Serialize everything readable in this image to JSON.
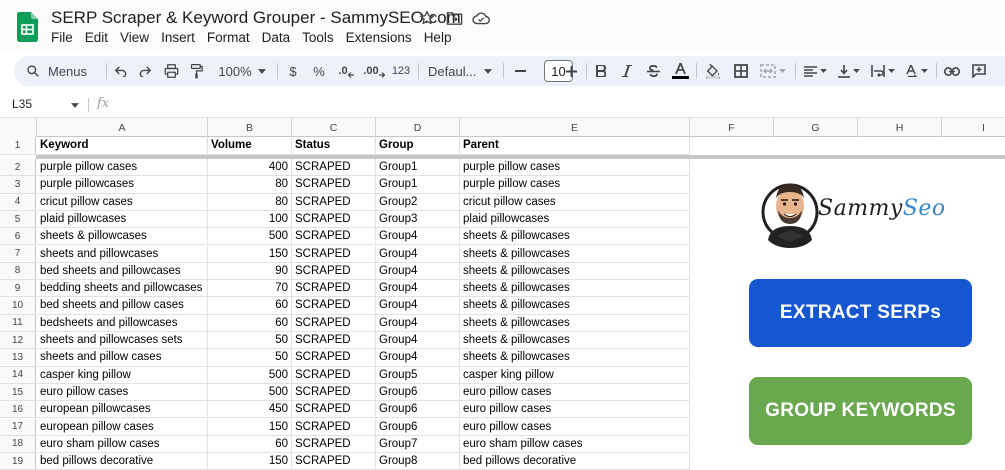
{
  "window": {
    "title": "SERP Scraper & Keyword Grouper - SammySEO.com",
    "menu": [
      "File",
      "Edit",
      "View",
      "Insert",
      "Format",
      "Data",
      "Tools",
      "Extensions",
      "Help"
    ]
  },
  "toolbar": {
    "search_label": "Menus",
    "zoom": "100%",
    "currency": "$",
    "percent": "%",
    "decrease_decimal": ".0",
    "increase_decimal": ".00",
    "number_format": "123",
    "font": "Defaul...",
    "font_size": "10"
  },
  "formula_bar": {
    "cell_ref": "L35",
    "fx": "fx"
  },
  "grid": {
    "columns": [
      "A",
      "B",
      "C",
      "D",
      "E",
      "F",
      "G",
      "H",
      "I"
    ],
    "header_row": [
      "Keyword",
      "Volume",
      "Status",
      "Group",
      "Parent"
    ],
    "rows": [
      [
        "2",
        "purple pillow cases",
        "400",
        "SCRAPED",
        "Group1",
        "purple pillow cases"
      ],
      [
        "3",
        "purple pillowcases",
        "80",
        "SCRAPED",
        "Group1",
        "purple pillow cases"
      ],
      [
        "4",
        "cricut pillow cases",
        "80",
        "SCRAPED",
        "Group2",
        "cricut pillow cases"
      ],
      [
        "5",
        "plaid pillowcases",
        "100",
        "SCRAPED",
        "Group3",
        "plaid pillowcases"
      ],
      [
        "6",
        "sheets & pillowcases",
        "500",
        "SCRAPED",
        "Group4",
        "sheets & pillowcases"
      ],
      [
        "7",
        "sheets and pillowcases",
        "150",
        "SCRAPED",
        "Group4",
        "sheets & pillowcases"
      ],
      [
        "8",
        "bed sheets and pillowcases",
        "90",
        "SCRAPED",
        "Group4",
        "sheets & pillowcases"
      ],
      [
        "9",
        "bedding sheets and pillowcases",
        "70",
        "SCRAPED",
        "Group4",
        "sheets & pillowcases"
      ],
      [
        "10",
        "bed sheets and pillow cases",
        "60",
        "SCRAPED",
        "Group4",
        "sheets & pillowcases"
      ],
      [
        "11",
        "bedsheets and pillowcases",
        "60",
        "SCRAPED",
        "Group4",
        "sheets & pillowcases"
      ],
      [
        "12",
        "sheets and pillowcases sets",
        "50",
        "SCRAPED",
        "Group4",
        "sheets & pillowcases"
      ],
      [
        "13",
        "sheets and pillow cases",
        "50",
        "SCRAPED",
        "Group4",
        "sheets & pillowcases"
      ],
      [
        "14",
        "casper king pillow",
        "500",
        "SCRAPED",
        "Group5",
        "casper king pillow"
      ],
      [
        "15",
        "euro pillow cases",
        "500",
        "SCRAPED",
        "Group6",
        "euro pillow cases"
      ],
      [
        "16",
        "european pillowcases",
        "450",
        "SCRAPED",
        "Group6",
        "euro pillow cases"
      ],
      [
        "17",
        "european pillow cases",
        "150",
        "SCRAPED",
        "Group6",
        "euro pillow cases"
      ],
      [
        "18",
        "euro sham pillow cases",
        "60",
        "SCRAPED",
        "Group7",
        "euro sham pillow cases"
      ],
      [
        "19",
        "bed pillows decorative",
        "150",
        "SCRAPED",
        "Group8",
        "bed pillows decorative"
      ]
    ]
  },
  "panel": {
    "logo_text_1": "Sammy",
    "logo_text_2": "Seo",
    "extract_button": "EXTRACT SERPs",
    "group_button": "GROUP KEYWORDS"
  },
  "colors": {
    "extract_button": "#1457d1",
    "group_button": "#6aa84f",
    "sheets_green": "#0f9d58"
  }
}
